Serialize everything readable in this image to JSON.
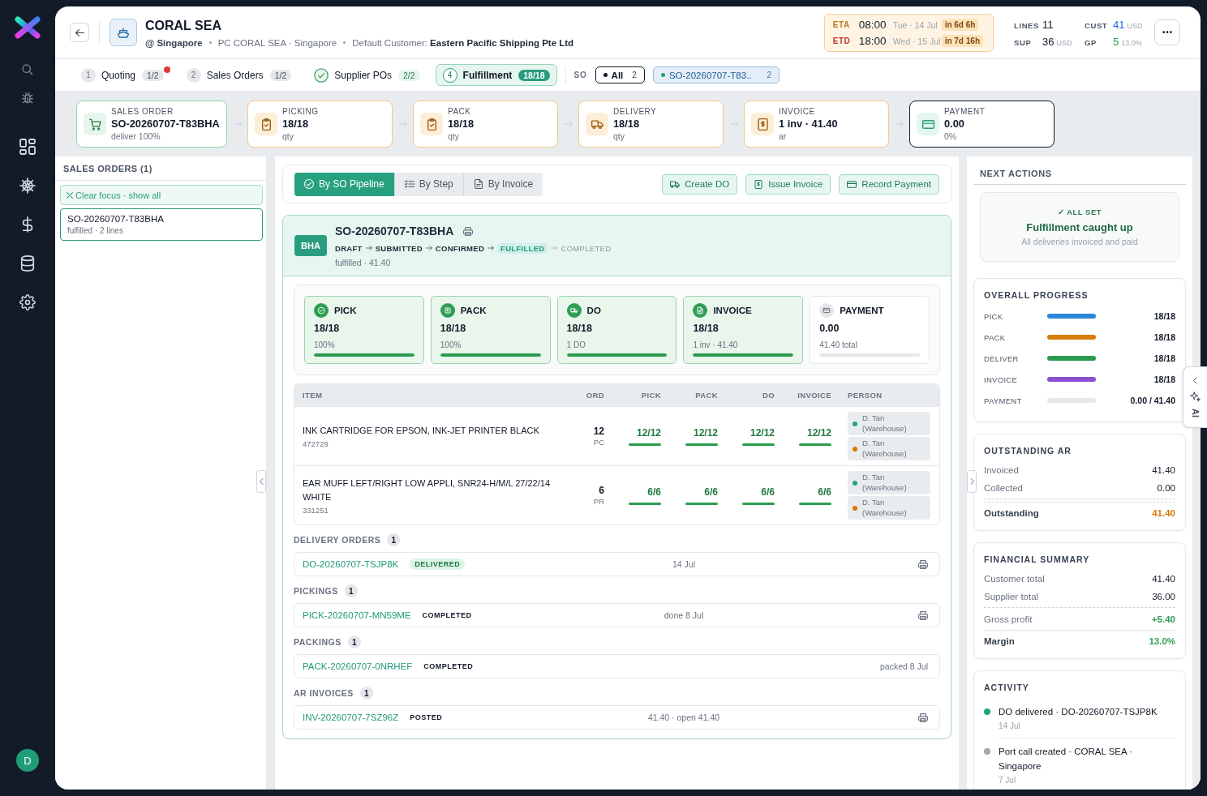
{
  "user": {
    "initial": "D"
  },
  "header": {
    "title": "CORAL SEA",
    "meta": [
      {
        "kind": "location",
        "text": "@ Singapore"
      },
      {
        "kind": "port_call",
        "text": "PC CORAL SEA · Singapore"
      },
      {
        "kind": "customer",
        "text": "Default Customer: **Eastern Pacific Shipping Pte Ltd**"
      }
    ]
  },
  "schedule": [
    {
      "label": "ETA",
      "time": "08:00",
      "date": "Tue · 14 Jul",
      "countdown": "in 6d 6h",
      "color": "#b7791f"
    },
    {
      "label": "ETD",
      "time": "18:00",
      "date": "Wed · 15 Jul",
      "countdown": "in 7d 16h",
      "color": "#c53030"
    }
  ],
  "stats": [
    {
      "label": "LINES",
      "value": "11",
      "color": "#111827"
    },
    {
      "label": "CUST",
      "value": "41",
      "unit": "USD",
      "color": "#2563eb"
    },
    {
      "label": "SUP",
      "value": "36",
      "unit": "USD",
      "color": "#111827"
    },
    {
      "label": "GP",
      "value": "5",
      "unit": "13.0%",
      "color": "#2f9e55"
    }
  ],
  "steps": [
    {
      "number": "1",
      "label": "Quoting",
      "count": "1/2",
      "done": false,
      "alert": true,
      "selected": false
    },
    {
      "number": "2",
      "label": "Sales Orders",
      "count": "1/2",
      "done": false,
      "alert": false,
      "selected": false
    },
    {
      "label": "Supplier POs",
      "count": "2/2",
      "done": true,
      "alert": false,
      "selected": false
    },
    {
      "number": "4",
      "label": "Fulfillment",
      "count": "18/18",
      "done": false,
      "alert": false,
      "selected": true
    }
  ],
  "filter": {
    "label": "SO",
    "chips": [
      {
        "kind": "all",
        "label": "All",
        "count": "2",
        "color": "#111827",
        "selected": true
      },
      {
        "kind": "order",
        "label": "SO-20260707-T83..",
        "count": "2",
        "color": "#22a06b",
        "selected": false
      }
    ]
  },
  "pipeline_summary": [
    {
      "kind": "sales_order",
      "label": "SALES ORDER",
      "value": "SO-20260707-T83BHA",
      "note": "deliver 100%",
      "complete": true,
      "selected": false
    },
    {
      "kind": "picking",
      "label": "PICKING",
      "value": "18/18",
      "note": "qty",
      "complete": false,
      "selected": false
    },
    {
      "kind": "pack",
      "label": "PACK",
      "value": "18/18",
      "note": "qty",
      "complete": false,
      "selected": false
    },
    {
      "kind": "delivery",
      "label": "DELIVERY",
      "value": "18/18",
      "note": "qty",
      "complete": false,
      "selected": false
    },
    {
      "kind": "invoice",
      "label": "INVOICE",
      "value": "1 inv · 41.40",
      "note": "ar",
      "complete": false,
      "selected": false
    },
    {
      "kind": "payment",
      "label": "PAYMENT",
      "value": "0.00",
      "note": "0%",
      "complete": false,
      "selected": true
    }
  ],
  "sales_orders": {
    "title": "SALES ORDERS (1)",
    "clear_label": "Clear focus · show all",
    "items": [
      {
        "number": "SO-20260707-T83BHA",
        "summary": "fulfilled · 2 lines",
        "selected": true
      }
    ]
  },
  "views": [
    {
      "kind": "pipeline",
      "label": "By SO Pipeline",
      "selected": true
    },
    {
      "kind": "step",
      "label": "By Step",
      "selected": false
    },
    {
      "kind": "invoice",
      "label": "By Invoice",
      "selected": false
    }
  ],
  "actions": [
    {
      "kind": "delivery",
      "label": "Create DO"
    },
    {
      "kind": "invoice",
      "label": "Issue Invoice"
    },
    {
      "kind": "payment",
      "label": "Record Payment"
    }
  ],
  "order": {
    "badge": "BHA",
    "number": "SO-20260707-T83BHA",
    "stages": [
      {
        "label": "DRAFT",
        "current": false
      },
      {
        "label": "SUBMITTED",
        "current": false
      },
      {
        "label": "CONFIRMED",
        "current": false
      },
      {
        "label": "FULFILLED",
        "current": true
      },
      {
        "label": "COMPLETED",
        "current": false
      }
    ],
    "summary": "fulfilled · 41.40",
    "step_cards": [
      {
        "kind": "pick",
        "label": "PICK",
        "value": "18/18",
        "note": "100%",
        "done": true,
        "level": 1
      },
      {
        "kind": "pack",
        "label": "PACK",
        "value": "18/18",
        "note": "100%",
        "done": true,
        "level": 1
      },
      {
        "kind": "delivery",
        "label": "DO",
        "value": "18/18",
        "note": "1 DO",
        "done": true,
        "level": 1
      },
      {
        "kind": "invoice",
        "label": "INVOICE",
        "value": "18/18",
        "note": "1 inv · 41.40",
        "done": true,
        "level": 1
      },
      {
        "kind": "payment",
        "label": "PAYMENT",
        "value": "0.00",
        "note": "41.40 total",
        "done": false,
        "level": 0
      }
    ],
    "table": {
      "columns": [
        "ITEM",
        "ORD",
        "PICK",
        "PACK",
        "DO",
        "INVOICE",
        "PERSON"
      ],
      "rows": [
        {
          "item": "INK CARTRIDGE FOR EPSON, INK-JET PRINTER BLACK",
          "code": "472729",
          "ordered": "12",
          "unit": "PC",
          "quantities": [
            {
              "value": "12/12",
              "level": 1
            },
            {
              "value": "12/12",
              "level": 1
            },
            {
              "value": "12/12",
              "level": 1
            },
            {
              "value": "12/12",
              "level": 1
            }
          ],
          "people": [
            {
              "name": "D. Tan",
              "role": "(Warehouse)",
              "color": "#20a486"
            },
            {
              "name": "D. Tan",
              "role": "(Warehouse)",
              "color": "#d97706"
            }
          ]
        },
        {
          "item": "EAR MUFF LEFT/RIGHT LOW APPLI, SNR24-H/M/L 27/22/14 WHITE",
          "code": "331251",
          "ordered": "6",
          "unit": "PR",
          "quantities": [
            {
              "value": "6/6",
              "level": 1
            },
            {
              "value": "6/6",
              "level": 1
            },
            {
              "value": "6/6",
              "level": 1
            },
            {
              "value": "6/6",
              "level": 1
            }
          ],
          "people": [
            {
              "name": "D. Tan",
              "role": "(Warehouse)",
              "color": "#20a486"
            },
            {
              "name": "D. Tan",
              "role": "(Warehouse)",
              "color": "#d97706"
            }
          ]
        }
      ]
    },
    "sections": [
      {
        "title": "DELIVERY ORDERS",
        "count": "1",
        "records": [
          {
            "number": "DO-20260707-TSJP8K",
            "status": "DELIVERED",
            "highlighted": true,
            "note": "14 Jul",
            "printable": true
          }
        ]
      },
      {
        "title": "PICKINGS",
        "count": "1",
        "records": [
          {
            "number": "PICK-20260707-MN59ME",
            "status": "COMPLETED",
            "highlighted": false,
            "note": "done 8 Jul",
            "printable": true
          }
        ]
      },
      {
        "title": "PACKINGS",
        "count": "1",
        "records": [
          {
            "number": "PACK-20260707-0NRHEF",
            "status": "COMPLETED",
            "highlighted": false,
            "note": "packed 8 Jul",
            "printable": false
          }
        ]
      },
      {
        "title": "AR INVOICES",
        "count": "1",
        "records": [
          {
            "number": "INV-20260707-7SZ96Z",
            "status": "POSTED",
            "highlighted": false,
            "note": "41.40 · open 41.40",
            "printable": true
          }
        ]
      }
    ]
  },
  "next_actions": {
    "title": "NEXT ACTIONS",
    "status": "✓ ALL SET",
    "headline": "Fulfillment caught up",
    "message": "All deliveries invoiced and paid"
  },
  "overall_progress": {
    "title": "OVERALL PROGRESS",
    "rows": [
      {
        "label": "PICK",
        "level": 1,
        "value": "18/18",
        "color": "#2b88d8"
      },
      {
        "label": "PACK",
        "level": 1,
        "value": "18/18",
        "color": "#d97d0d"
      },
      {
        "label": "DELIVER",
        "level": 1,
        "value": "18/18",
        "color": "#2a9b4e"
      },
      {
        "label": "INVOICE",
        "level": 1,
        "value": "18/18",
        "color": "#8a4fd0"
      },
      {
        "label": "PAYMENT",
        "level": 0,
        "value": "0.00 / 41.40"
      }
    ]
  },
  "outstanding_ar": {
    "title": "OUTSTANDING AR",
    "rows": [
      {
        "label": "Invoiced",
        "value": "41.40",
        "kind": "line"
      },
      {
        "label": "Collected",
        "value": "0.00",
        "kind": "line"
      },
      {
        "label": "Outstanding",
        "value": "41.40",
        "kind": "total",
        "color": "#d97706"
      }
    ]
  },
  "financial_summary": {
    "title": "FINANCIAL SUMMARY",
    "rows": [
      {
        "label": "Customer total",
        "value": "41.40",
        "kind": "line"
      },
      {
        "label": "Supplier total",
        "value": "36.00",
        "kind": "line"
      },
      {
        "label": "Gross profit",
        "value": "+5.40",
        "kind": "net",
        "color": "#2f9e55"
      },
      {
        "label": "Margin",
        "value": "13.0%",
        "kind": "total",
        "color": "#2f9e55"
      }
    ]
  },
  "activity": {
    "title": "ACTIVITY",
    "items": [
      {
        "text": "DO delivered · DO-20260707-TSJP8K",
        "date": "14 Jul",
        "color": "#20a486"
      },
      {
        "text": "Port call created · CORAL SEA · Singapore",
        "date": "7 Jul",
        "color": "#a0a6b1"
      }
    ]
  },
  "assistant_tab": {
    "label": "AI"
  }
}
